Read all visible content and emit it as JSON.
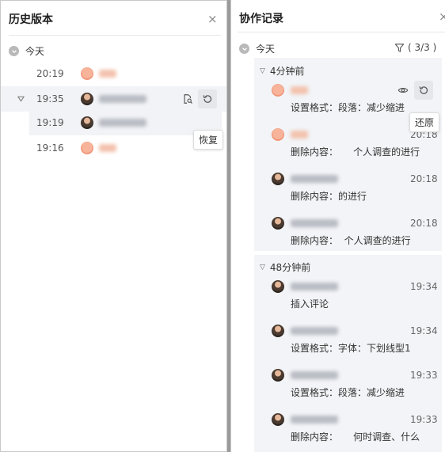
{
  "history_panel": {
    "title": "历史版本",
    "close_glyph": "×",
    "today_label": "今天",
    "versions": [
      {
        "time": "20:19"
      },
      {
        "time": "19:35"
      },
      {
        "time": "19:19"
      },
      {
        "time": "19:16"
      }
    ],
    "restore_tooltip": "恢复"
  },
  "collab_panel": {
    "title": "协作记录",
    "close_glyph": "×",
    "today_label": "今天",
    "filter_count": "( 3/3 )",
    "restore_tooltip": "还原",
    "groups": [
      {
        "label": "4分钟前",
        "records": [
          {
            "time": "",
            "desc": "设置格式：段落：减少缩进"
          },
          {
            "time": "20:18",
            "desc": "删除内容：     个人调查的进行"
          },
          {
            "time": "20:18",
            "desc": "删除内容：的进行"
          },
          {
            "time": "20:18",
            "desc": "删除内容：  个人调查的进行"
          }
        ]
      },
      {
        "label": "48分钟前",
        "records": [
          {
            "time": "19:34",
            "desc": "插入评论"
          },
          {
            "time": "19:34",
            "desc": "设置格式：字体：下划线型1"
          },
          {
            "time": "19:33",
            "desc": "设置格式：段落：减少缩进"
          },
          {
            "time": "19:33",
            "desc": "删除内容：     何时调查、什么"
          }
        ]
      }
    ]
  },
  "colors": {
    "highlight_row": "#f1f3f6",
    "group_bg": "#f2f4f7",
    "avatar_orange": "#f1957a",
    "backdrop": "#9a9a9a"
  },
  "icons": {
    "close": "close-icon",
    "chevron": "chevron-down-icon",
    "preview": "file-search-icon",
    "restore": "undo-icon",
    "filter": "filter-icon",
    "eye": "eye-icon"
  }
}
